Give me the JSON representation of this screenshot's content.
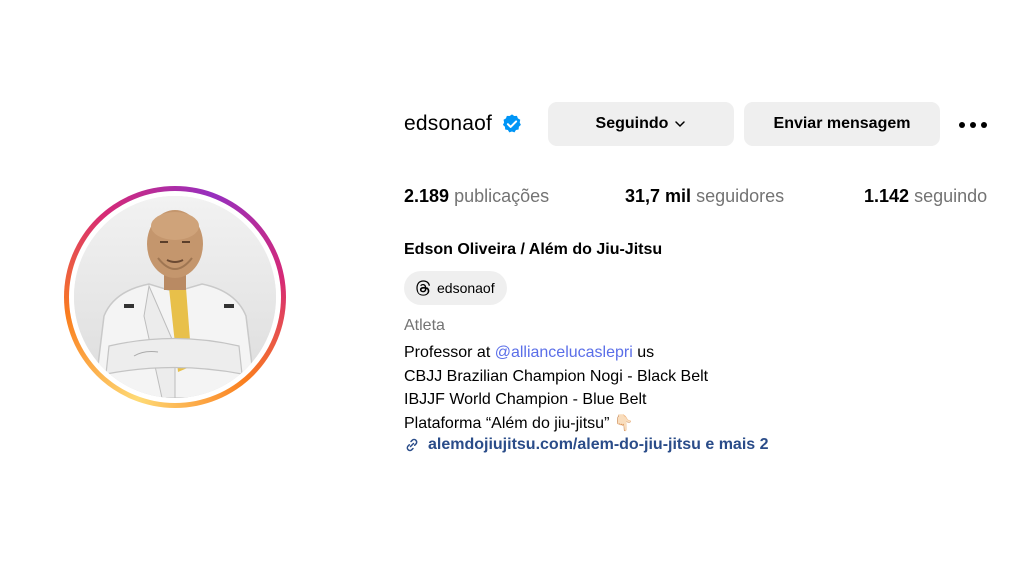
{
  "profile": {
    "username": "edsonaof",
    "verified": true,
    "full_name": "Edson Oliveira / Além do Jiu-Jitsu",
    "category": "Atleta"
  },
  "actions": {
    "follow_label": "Seguindo",
    "message_label": "Enviar mensagem",
    "more_icon": "more-horizontal-icon"
  },
  "stats": {
    "posts": {
      "value": "2.189",
      "label": "publicações"
    },
    "followers": {
      "value": "31,7 mil",
      "label": "seguidores"
    },
    "following": {
      "value": "1.142",
      "label": "seguindo"
    }
  },
  "threads_badge": {
    "label": "edsonaof",
    "icon": "threads-icon"
  },
  "bio": {
    "line1_prefix": "Professor at ",
    "line1_mention": "@alliancelucaslepri",
    "line1_suffix": " us",
    "line2": "CBJJ Brazilian Champion Nogi - Black Belt",
    "line3": "IBJJF World Champion - Blue Belt",
    "line4": "Plataforma “Além do jiu-jitsu” 👇🏻"
  },
  "link": {
    "text": "alemdojiujitsu.com/alem-do-jiu-jitsu e mais 2",
    "icon": "link-icon"
  },
  "colors": {
    "verified": "#0095f6",
    "mention": "#5a6ee8",
    "link": "#2a4c89",
    "button_bg": "#efefef",
    "muted": "#737373"
  }
}
